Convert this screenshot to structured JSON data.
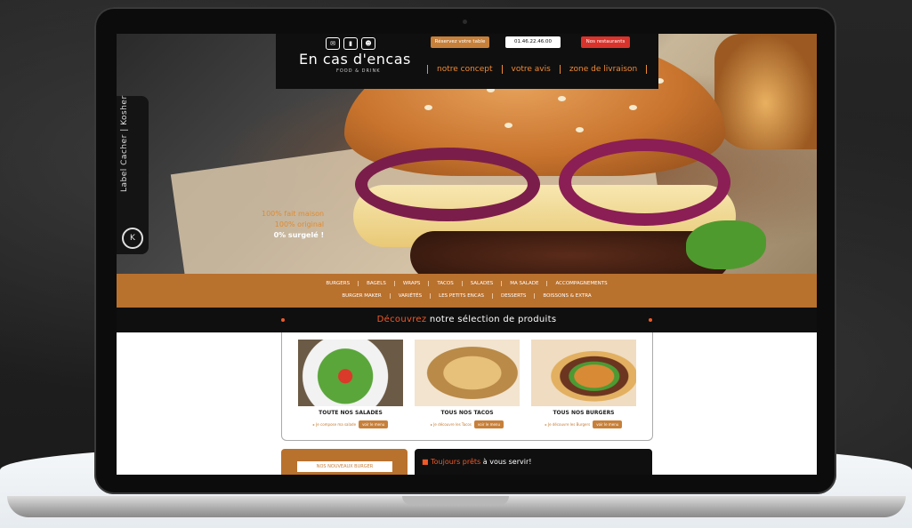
{
  "header": {
    "logo_icons": [
      "✉",
      "▮",
      "☻"
    ],
    "logo_text": "En cas d'encas",
    "logo_sub": "FOOD & DRINK",
    "btn_reserve": "Réservez votre table",
    "btn_phone": "01.46.22.46.00",
    "btn_restaurants": "Nos restaurants",
    "nav": [
      "notre concept",
      "votre avis",
      "zone de livraison"
    ]
  },
  "side": {
    "label": "Label Cacher | Kosher",
    "badge": "K"
  },
  "hero": {
    "line1": "100% fait maison",
    "line2": "100% original",
    "line3": "0% surgelé !"
  },
  "categories": {
    "row1": [
      "BURGERS",
      "BAGELS",
      "WRAPS",
      "TACOS",
      "SALADES",
      "MA SALADE",
      "ACCOMPAGNEMENTS"
    ],
    "row2": [
      "BURGER MAKER",
      "VARIÉTÉS",
      "LES PETITS ENCAS",
      "DESSERTS",
      "BOISSONS & EXTRA"
    ]
  },
  "selection": {
    "title_accent": "Découvrez",
    "title_rest": " notre sélection de produits"
  },
  "products": [
    {
      "caption": "TOUTE NOS SALADES",
      "link": "Je compose ma salade",
      "menu": "voir le menu"
    },
    {
      "caption": "TOUS NOS TACOS",
      "link": "Je découvre les Tacos",
      "menu": "voir le menu"
    },
    {
      "caption": "TOUS NOS BURGERS",
      "link": "Je découvre les Burgers",
      "menu": "voir le menu"
    }
  ],
  "bottom": {
    "left_label": "NOS NOUVEAUX BURGER",
    "right_accent": "Toujours prêts",
    "right_rest": " à vous servir!"
  },
  "colors": {
    "accent_orange": "#f05a28",
    "band_brown": "#b9712e",
    "header_black": "#0f0f0f"
  }
}
